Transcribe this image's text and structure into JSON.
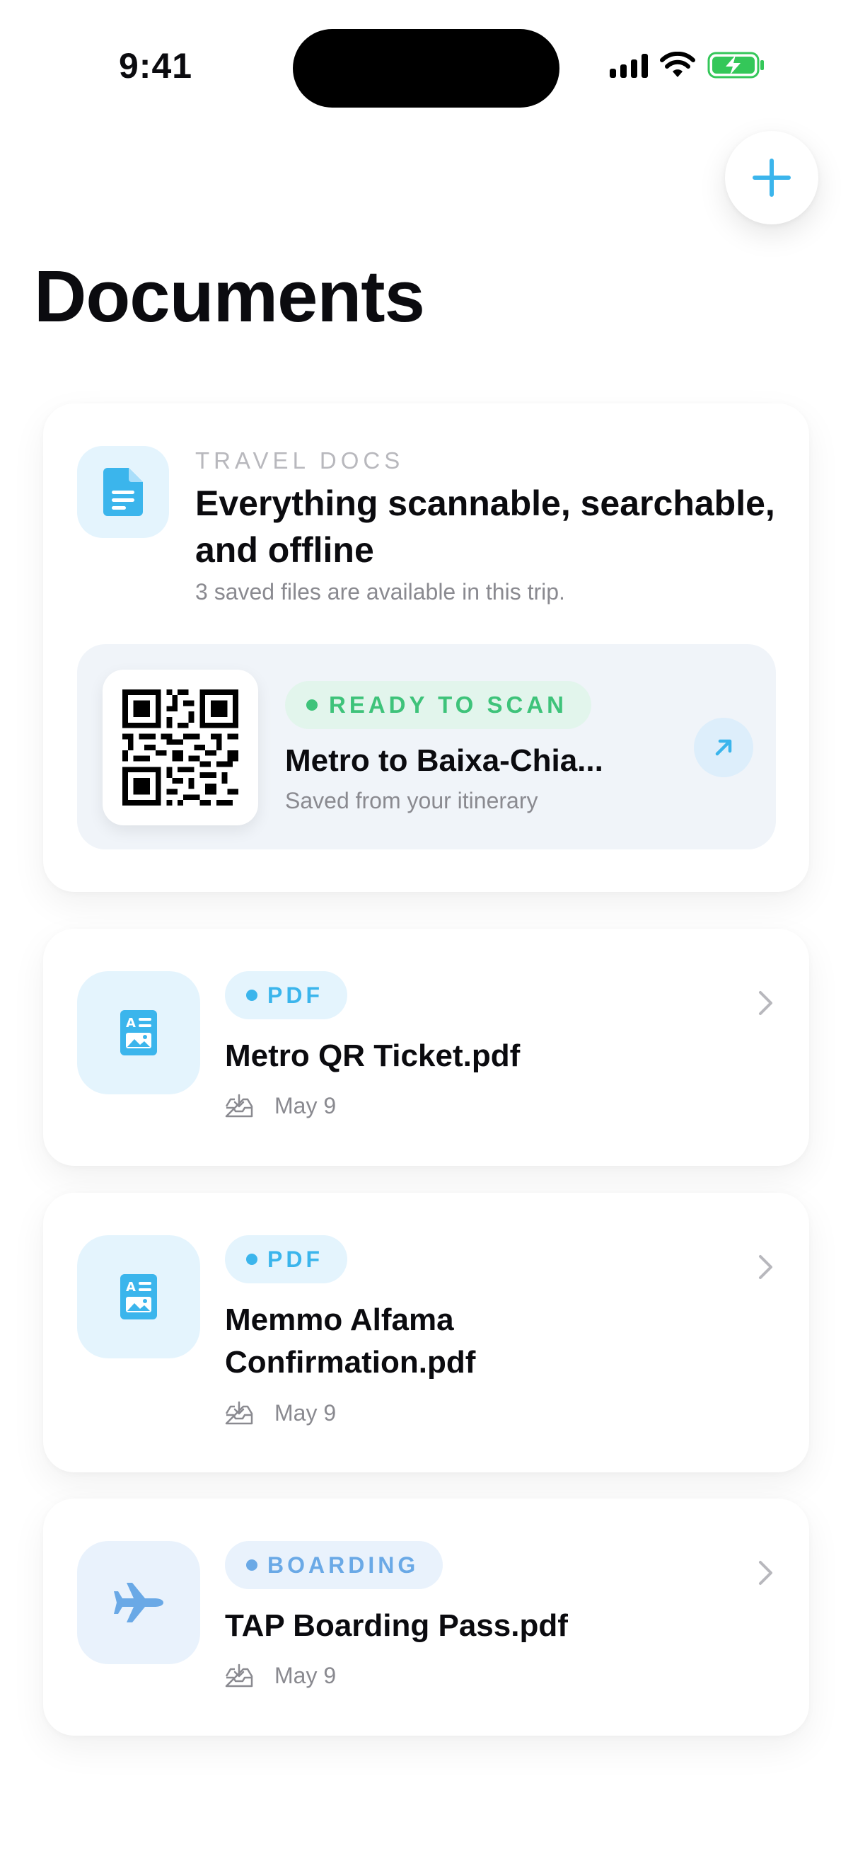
{
  "status": {
    "time": "9:41"
  },
  "header": {
    "title": "Documents",
    "add_icon": "plus-icon"
  },
  "hero": {
    "label": "TRAVEL DOCS",
    "title": "Everything scannable, searchable, and offline",
    "subtitle": "3 saved files are available in this trip.",
    "icon": "document-icon",
    "scan": {
      "badge": "READY TO SCAN",
      "title": "Metro to Baixa-Chia...",
      "subtitle": "Saved from your itinerary",
      "open_icon": "arrow-up-right-icon"
    }
  },
  "files": [
    {
      "tag": "PDF",
      "name": "Metro QR Ticket.pdf",
      "date": "May 9",
      "icon": "image-document-icon"
    },
    {
      "tag": "PDF",
      "name": "Memmo Alfama Confirmation.pdf",
      "date": "May 9",
      "icon": "image-document-icon"
    },
    {
      "tag": "BOARDING",
      "name": "TAP Boarding Pass.pdf",
      "date": "May 9",
      "icon": "airplane-icon"
    }
  ],
  "colors": {
    "accent": "#3bb5ec",
    "green": "#3ec37a",
    "boarding": "#6aa9e6",
    "text": "#0b0b0f",
    "muted": "#8a8a90"
  }
}
